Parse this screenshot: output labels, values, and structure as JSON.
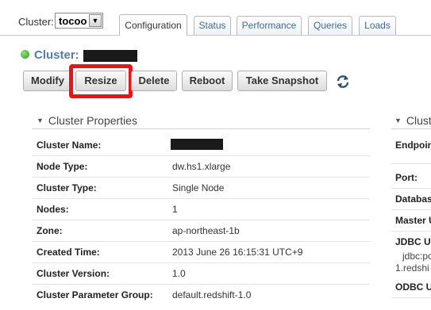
{
  "cluster_selector": {
    "label": "Cluster:",
    "value": "tocoo"
  },
  "tabs": [
    {
      "label": "Configuration",
      "active": true
    },
    {
      "label": "Status"
    },
    {
      "label": "Performance"
    },
    {
      "label": "Queries"
    },
    {
      "label": "Loads"
    }
  ],
  "cluster": {
    "title": "Cluster:",
    "status_color": "#2f9e1c"
  },
  "toolbar": {
    "modify": "Modify",
    "resize": "Resize",
    "delete": "Delete",
    "reboot": "Reboot",
    "snapshot": "Take Snapshot",
    "highlight_color": "#e8141a"
  },
  "properties": {
    "heading": "Cluster Properties",
    "rows": [
      {
        "label": "Cluster Name:",
        "value": ""
      },
      {
        "label": "Node Type:",
        "value": "dw.hs1.xlarge"
      },
      {
        "label": "Cluster Type:",
        "value": "Single Node"
      },
      {
        "label": "Nodes:",
        "value": "1"
      },
      {
        "label": "Zone:",
        "value": "ap-northeast-1b"
      },
      {
        "label": "Created Time:",
        "value": "2013 June 26 16:15:31 UTC+9"
      },
      {
        "label": "Cluster Version:",
        "value": "1.0"
      },
      {
        "label": "Cluster Parameter Group:",
        "value": "default.redshift-1.0"
      }
    ]
  },
  "right_panel": {
    "heading": "Clust",
    "labels": [
      "Endpoin",
      "Port:",
      "Databas",
      "Master U",
      "JDBC UF",
      "ODBC U"
    ],
    "jdbc_value_lines": [
      "jdbc:po",
      "1.redshi"
    ]
  }
}
